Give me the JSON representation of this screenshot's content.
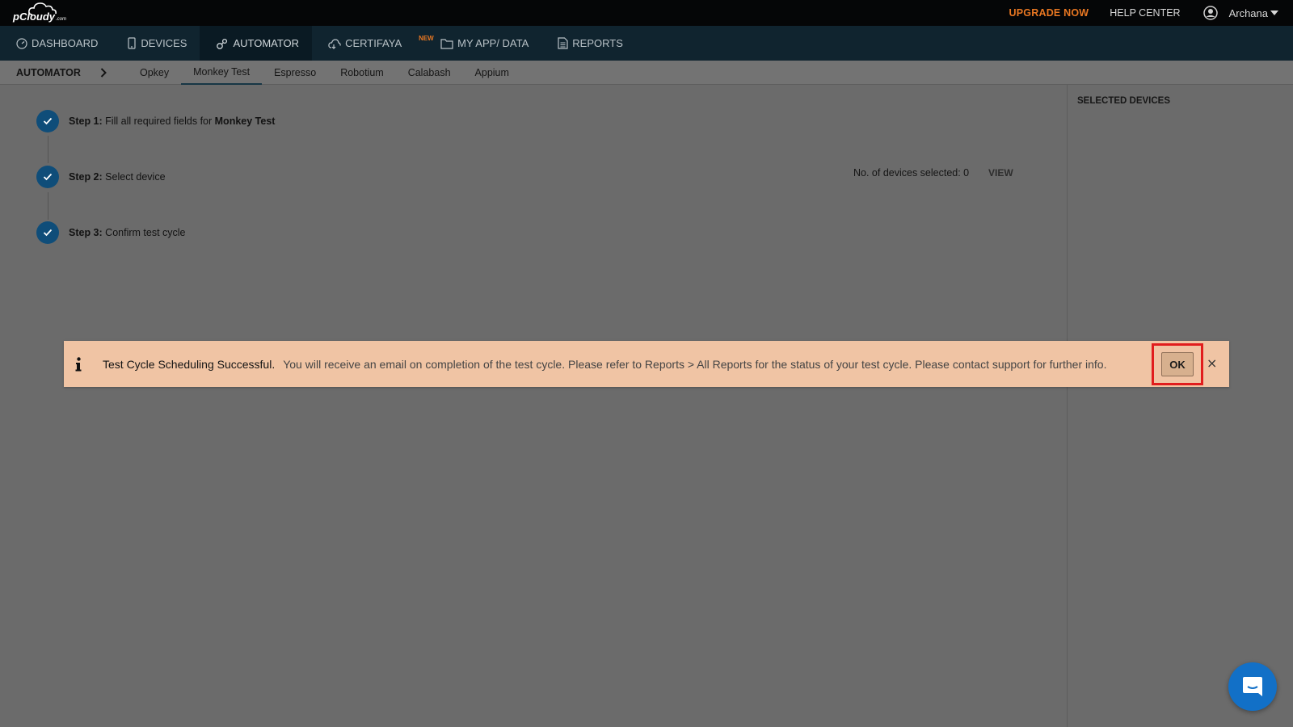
{
  "topbar": {
    "logo_text": "pCloudy",
    "logo_suffix": ".com",
    "upgrade_label": "UPGRADE NOW",
    "help_label": "HELP CENTER",
    "user_name": "Archana",
    "upgrade_color": "#e87722"
  },
  "main_nav": {
    "items": [
      {
        "label": "DASHBOARD",
        "icon": "dashboard-icon"
      },
      {
        "label": "DEVICES",
        "icon": "device-icon"
      },
      {
        "label": "AUTOMATOR",
        "icon": "automator-icon",
        "active": true
      },
      {
        "label": "CERTIFAYA",
        "icon": "cloud-icon",
        "badge": "NEW"
      },
      {
        "label": "MY APP/ DATA",
        "icon": "folder-icon"
      },
      {
        "label": "REPORTS",
        "icon": "report-icon"
      }
    ]
  },
  "sub_nav": {
    "title": "AUTOMATOR",
    "tabs": [
      {
        "label": "Opkey"
      },
      {
        "label": "Monkey Test",
        "active": true
      },
      {
        "label": "Espresso"
      },
      {
        "label": "Robotium"
      },
      {
        "label": "Calabash"
      },
      {
        "label": "Appium"
      }
    ]
  },
  "steps": [
    {
      "label": "Step 1:",
      "text": "Fill all required fields for ",
      "emphasis": "Monkey Test"
    },
    {
      "label": "Step 2:",
      "text": "Select device",
      "emphasis": ""
    },
    {
      "label": "Step 3:",
      "text": "Confirm test cycle",
      "emphasis": ""
    }
  ],
  "devices": {
    "count_label": "No. of devices selected: 0",
    "view_label": "VIEW"
  },
  "right_panel": {
    "title": "SELECTED DEVICES"
  },
  "alert": {
    "title": "Test Cycle Scheduling Successful.",
    "message": "You will receive an email on completion of the test cycle. Please refer to Reports > All Reports for the status of your test cycle. Please contact support for further info.",
    "ok_label": "OK",
    "close_label": "×",
    "background": "#f0c4a4",
    "highlight_color": "#e11d1d"
  },
  "chat": {
    "icon": "chat-icon",
    "color": "#1270c7"
  }
}
